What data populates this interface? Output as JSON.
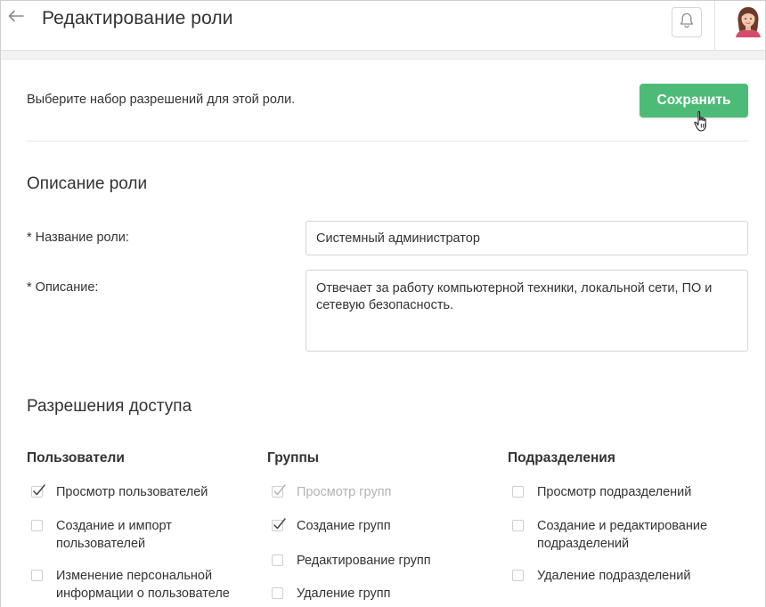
{
  "header": {
    "title": "Редактирование роли",
    "icons": {
      "back": "arrow-left-icon",
      "bell": "bell-icon",
      "avatar": "user-avatar"
    }
  },
  "intro": "Выберите набор разрешений для этой роли.",
  "save_button": {
    "label": "Сохранить",
    "color": "#4dbb78"
  },
  "description_section": {
    "title": "Описание роли",
    "name_label": "* Название роли:",
    "name_value": "Системный администратор",
    "desc_label": "* Описание:",
    "desc_value": "Отвечает за работу компьютерной техники, локальной сети, ПО и сетевую безопасность."
  },
  "permissions": {
    "title": "Разрешения доступа",
    "columns": [
      {
        "heading": "Пользователи",
        "items": [
          {
            "label": "Просмотр пользователей",
            "checked": true,
            "disabled": false
          },
          {
            "label": "Создание и импорт пользователей",
            "checked": false,
            "disabled": false
          },
          {
            "label": "Изменение персональной информации о пользователе",
            "checked": false,
            "disabled": false
          }
        ]
      },
      {
        "heading": "Группы",
        "items": [
          {
            "label": "Просмотр групп",
            "checked": true,
            "disabled": true
          },
          {
            "label": "Создание групп",
            "checked": true,
            "disabled": false
          },
          {
            "label": "Редактирование групп",
            "checked": false,
            "disabled": false
          },
          {
            "label": "Удаление групп",
            "checked": false,
            "disabled": false
          }
        ]
      },
      {
        "heading": "Подразделения",
        "items": [
          {
            "label": "Просмотр подразделений",
            "checked": false,
            "disabled": false
          },
          {
            "label": "Создание и редактирование подразделений",
            "checked": false,
            "disabled": false
          },
          {
            "label": "Удаление подразделений",
            "checked": false,
            "disabled": false
          }
        ]
      }
    ]
  }
}
